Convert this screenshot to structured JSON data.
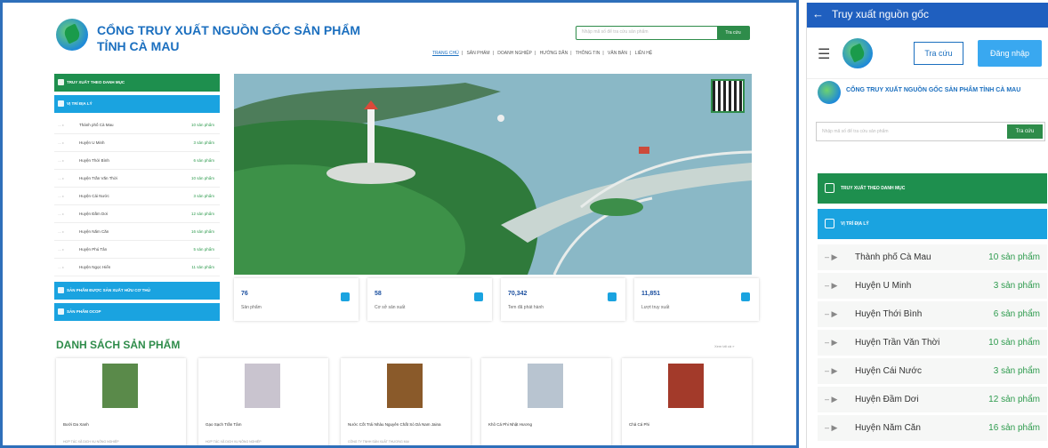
{
  "desktop": {
    "title_line1": "CỔNG TRUY XUẤT NGUỒN GỐC SẢN PHẨM",
    "title_line2": "TỈNH CÀ MAU",
    "search_placeholder": "Nhập mã số để tra cứu sản phẩm",
    "search_button": "Tra cứu",
    "nav": [
      "TRANG CHỦ",
      "SẢN PHẨM",
      "DOANH NGHIỆP",
      "HƯỚNG DẪN",
      "THÔNG TIN",
      "VĂN BẢN",
      "LIÊN HỆ"
    ],
    "left_menu_top": "TRUY XUẤT THEO DANH MỤC",
    "left_menu_geo": "VỊ TRÍ ĐỊA LÝ",
    "districts": [
      {
        "name": "Thành phố Cà Mau",
        "count": "10 sản phẩm"
      },
      {
        "name": "Huyện U Minh",
        "count": "3 sản phẩm"
      },
      {
        "name": "Huyện Thới Bình",
        "count": "6 sản phẩm"
      },
      {
        "name": "Huyện Trần Văn Thời",
        "count": "10 sản phẩm"
      },
      {
        "name": "Huyện Cái Nước",
        "count": "3 sản phẩm"
      },
      {
        "name": "Huyện Đầm Dơi",
        "count": "12 sản phẩm"
      },
      {
        "name": "Huyện Năm Căn",
        "count": "16 sản phẩm"
      },
      {
        "name": "Huyện Phú Tân",
        "count": "5 sản phẩm"
      },
      {
        "name": "Huyện Ngọc Hiển",
        "count": "11 sản phẩm"
      }
    ],
    "left_menu_ocop": "SẢN PHẨM ĐƯỢC SẢN XUẤT HỮU CƠ THỦ",
    "left_menu_ocop2": "SẢN PHẨM OCOP",
    "stats": [
      {
        "num": "76",
        "label": "Sản phẩm"
      },
      {
        "num": "58",
        "label": "Cơ sở sản xuất"
      },
      {
        "num": "70,342",
        "label": "Tem đã phát hành"
      },
      {
        "num": "11,851",
        "label": "Lượt truy xuất"
      }
    ],
    "products_heading": "DANH SÁCH SẢN PHẨM",
    "see_all": "Xem tất cả »",
    "products": [
      {
        "name": "Bưởi Da Xanh",
        "desc": "HỢP TÁC XÃ DỊCH VỤ NÔNG NGHIỆP"
      },
      {
        "name": "Gạo Sạch Trần Tâm",
        "desc": "HỢP TÁC XÃ DỊCH VỤ NÔNG NGHIỆP"
      },
      {
        "name": "Nước Cốt Trái Nhàu Nguyên Chất Sò Dà Nam Jaina",
        "desc": "CÔNG TY TNHH SẢN XUẤT THƯƠNG MẠI"
      },
      {
        "name": "Khô Cá Phi Nhật Hương",
        "desc": ""
      },
      {
        "name": "Chả Cá Phi",
        "desc": ""
      }
    ]
  },
  "mobile": {
    "header": "Truy xuất nguồn gốc",
    "btn_search": "Tra cứu",
    "btn_login": "Đăng nhập",
    "title": "CỔNG TRUY XUẤT NGUỒN GỐC SẢN PHẨM TỈNH CÀ MAU",
    "search_placeholder": "Nhập mã số để tra cứu sản phẩm",
    "search_button": "Tra cứu",
    "menu_top": "TRUY XUẤT THEO DANH MỤC",
    "menu_geo": "VỊ TRÍ ĐỊA LÝ",
    "districts": [
      {
        "name": "Thành phố Cà Mau",
        "count": "10 sản phẩm"
      },
      {
        "name": "Huyện U Minh",
        "count": "3 sản phẩm"
      },
      {
        "name": "Huyện Thới Bình",
        "count": "6 sản phẩm"
      },
      {
        "name": "Huyện Trần Văn Thời",
        "count": "10 sản phẩm"
      },
      {
        "name": "Huyện Cái Nước",
        "count": "3 sản phẩm"
      },
      {
        "name": "Huyện Đầm Dơi",
        "count": "12 sản phẩm"
      },
      {
        "name": "Huyện Năm Căn",
        "count": "16 sản phẩm"
      }
    ]
  }
}
